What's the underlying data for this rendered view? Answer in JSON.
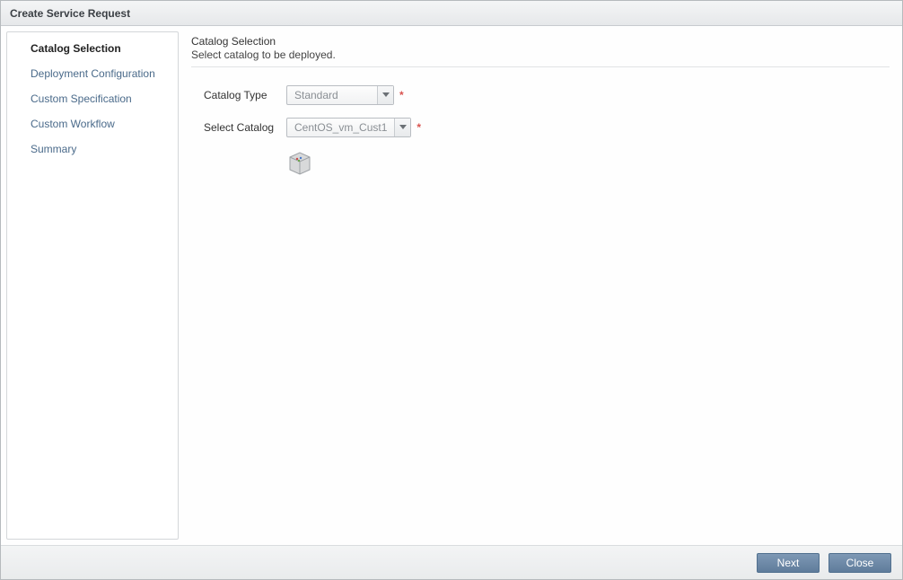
{
  "modal": {
    "title": "Create Service Request"
  },
  "sidebar": {
    "items": [
      {
        "label": "Catalog Selection",
        "active": true
      },
      {
        "label": "Deployment Configuration",
        "active": false
      },
      {
        "label": "Custom Specification",
        "active": false
      },
      {
        "label": "Custom Workflow",
        "active": false
      },
      {
        "label": "Summary",
        "active": false
      }
    ]
  },
  "content": {
    "title": "Catalog Selection",
    "subtitle": "Select catalog to be deployed."
  },
  "form": {
    "catalog_type": {
      "label": "Catalog Type",
      "value": "Standard",
      "required": "*"
    },
    "select_catalog": {
      "label": "Select Catalog",
      "value": "CentOS_vm_Cust1",
      "required": "*"
    }
  },
  "footer": {
    "next": "Next",
    "close": "Close"
  }
}
